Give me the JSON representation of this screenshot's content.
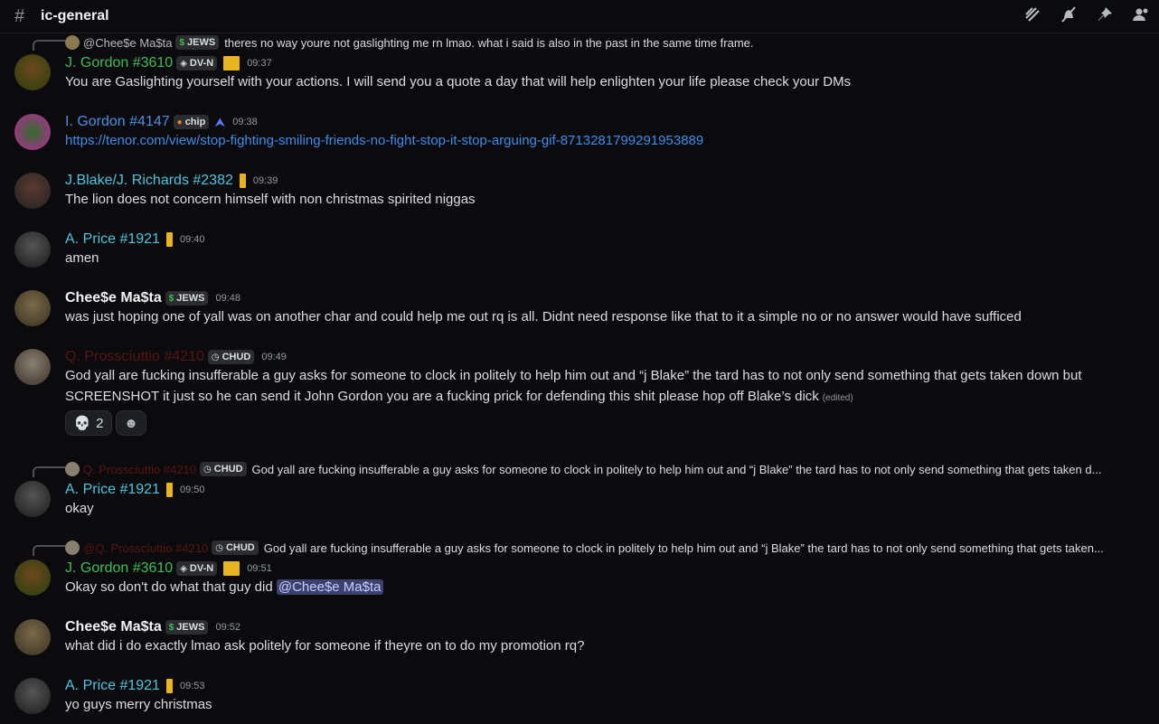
{
  "channel": {
    "name": "ic-general",
    "hash_icon": "hash-icon"
  },
  "toolbar": {
    "icons": [
      "threads-icon",
      "mute-bell-icon",
      "pin-icon",
      "members-icon"
    ]
  },
  "messages": [
    {
      "reply": {
        "author": "@Chee$e Ma$ta",
        "tag": "JEWS",
        "text": "theres no way youre not gaslighting me rn lmao. what i said is also in the past in the same time frame."
      },
      "author": "J. Gordon #3610",
      "tag": "DV-N",
      "time": "09:37",
      "text": "You are Gaslighting yourself with your actions. I will send you a quote a day that will help enlighten your life please check your DMs"
    },
    {
      "author": "I. Gordon #4147",
      "tag": "chip",
      "time": "09:38",
      "link": "https://tenor.com/view/stop-fighting-smiling-friends-no-fight-stop-it-stop-arguing-gif-8713281799291953889"
    },
    {
      "author": "J.Blake/J. Richards #2382",
      "time": "09:39",
      "text": "The lion does not concern himself with non christmas spirited niggas"
    },
    {
      "author": "A. Price #1921",
      "time": "09:40",
      "text": "amen"
    },
    {
      "author": "Chee$e Ma$ta",
      "tag": "JEWS",
      "time": "09:48",
      "text": "was just hoping one of yall was on another char and could help me out rq is all. Didnt need response like that to it a simple no or no answer  would have sufficed"
    },
    {
      "author": "Q. Prosscíuttio #4210",
      "tag": "CHUD",
      "time": "09:49",
      "line1": "God yall are fucking insufferable a guy asks for someone to clock in politely to help him out and “j Blake” the tard has to not only send something that gets taken down but",
      "line2": "SCREENSHOT it just so he can send it John Gordon you are a fucking prick for defending this shit please hop off Blake’s dick",
      "edited": "(edited)",
      "reactions": [
        {
          "icon": "skull-icon",
          "count": "2"
        },
        {
          "icon": "add-reaction-icon"
        }
      ]
    },
    {
      "reply": {
        "author": "Q. Prosscíuttio #4210",
        "tag": "CHUD",
        "text": "God yall are fucking insufferable a guy asks for someone to clock in politely to help him out and “j Blake” the tard has to not only send something that gets taken d..."
      },
      "author": "A. Price #1921",
      "time": "09:50",
      "text": "okay"
    },
    {
      "reply": {
        "author": "@Q. Prosscíuttio #4210",
        "tag": "CHUD",
        "text": "God yall are fucking insufferable a guy asks for someone to clock in politely to help him out and “j Blake” the tard has to not only send something that gets taken..."
      },
      "author": "J. Gordon #3610",
      "tag": "DV-N",
      "time": "09:51",
      "text": "Okay so don't do what that guy did",
      "mention": "@Chee$e Ma$ta"
    },
    {
      "author": "Chee$e Ma$ta",
      "tag": "JEWS",
      "time": "09:52",
      "text": "what did i do exactly lmao ask politely for someone if theyre on to do my promotion rq?"
    },
    {
      "author": "A. Price #1921",
      "time": "09:53",
      "text": "yo guys merry christmas"
    }
  ],
  "colors": {
    "background": "#0b0b0d",
    "green_role": "#3dbd58",
    "blue_role": "#4b8fe0",
    "cyan_role": "#4fc3e0",
    "link": "#3e8ce6",
    "dark_red_role": "#5a1414",
    "gold_badge": "#e8b422"
  }
}
